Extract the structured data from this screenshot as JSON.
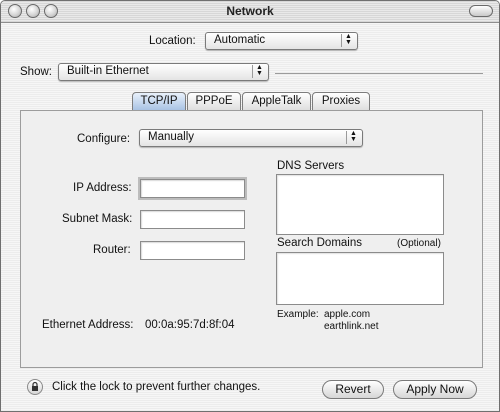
{
  "window": {
    "title": "Network"
  },
  "location": {
    "label": "Location:",
    "value": "Automatic"
  },
  "show": {
    "label": "Show:",
    "value": "Built-in Ethernet"
  },
  "tabs": [
    {
      "label": "TCP/IP"
    },
    {
      "label": "PPPoE"
    },
    {
      "label": "AppleTalk"
    },
    {
      "label": "Proxies"
    }
  ],
  "configure": {
    "label": "Configure:",
    "value": "Manually"
  },
  "fields": {
    "ip_label": "IP Address:",
    "subnet_label": "Subnet Mask:",
    "router_label": "Router:"
  },
  "dns": {
    "label": "DNS Servers"
  },
  "search_domains": {
    "label": "Search Domains",
    "optional": "(Optional)"
  },
  "example": {
    "label": "Example:",
    "line1": "apple.com",
    "line2": "earthlink.net"
  },
  "ethernet": {
    "label": "Ethernet Address:",
    "value": "00:0a:95:7d:8f:04"
  },
  "footer": {
    "lock_text": "Click the lock to prevent further changes.",
    "revert": "Revert",
    "apply": "Apply Now"
  }
}
